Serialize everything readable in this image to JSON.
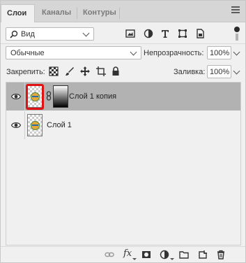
{
  "tabs": [
    {
      "label": "Слои",
      "active": true
    },
    {
      "label": "Каналы",
      "active": false
    },
    {
      "label": "Контуры",
      "active": false
    }
  ],
  "filter": {
    "kind_label": "Вид"
  },
  "blend": {
    "mode": "Обычные",
    "opacity_label": "Непрозрачность:",
    "opacity_value": "100%",
    "lock_label": "Закрепить:",
    "fill_label": "Заливка:",
    "fill_value": "100%"
  },
  "layers": [
    {
      "name": "Слой 1 копия",
      "selected": true,
      "has_mask": true,
      "visible": true
    },
    {
      "name": "Слой 1",
      "selected": false,
      "has_mask": false,
      "visible": true
    }
  ],
  "colors": {
    "highlight": "#e01212",
    "selected_row": "#b2b2b2",
    "panel_bg": "#f0f0f0"
  },
  "icons": {
    "filter": [
      "image-filter-icon",
      "adjustment-filter-icon",
      "type-filter-icon",
      "shape-filter-icon",
      "smart-object-filter-icon"
    ],
    "locks": [
      "lock-transparent-icon",
      "lock-image-icon",
      "lock-position-icon",
      "lock-artboard-icon",
      "lock-all-icon"
    ],
    "bottom": [
      "link-layers-icon",
      "fx-icon",
      "add-mask-icon",
      "adjustment-layer-icon",
      "new-group-icon",
      "new-layer-icon",
      "delete-icon"
    ]
  }
}
